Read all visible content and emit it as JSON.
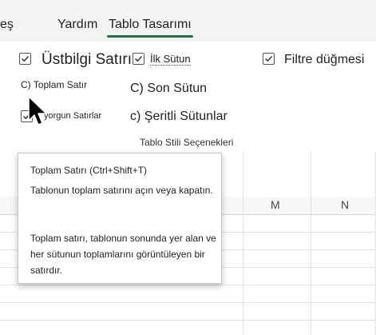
{
  "tabs": {
    "partial": "eş",
    "help": "Yardım",
    "table_design": "Tablo Tasarımı"
  },
  "ribbon": {
    "header_row": "Üstbilgi Satırı",
    "first_column": "İlk Sütun",
    "filter_button": "Filtre düğmesi",
    "total_row": "C) Toplam  Satır",
    "last_column": "C) Son Sütun",
    "banded_rows": "yorgun Satırlar",
    "banded_columns": "c) Şeritli Sütunlar",
    "group_label": "Tablo Stili Seçenekleri"
  },
  "columns": {
    "m": "M",
    "n": "N"
  },
  "tooltip": {
    "title": "Toplam Satırı (Ctrl+Shift+T)",
    "line1": "Tablonun toplam satırını açın veya kapatın.",
    "line2": "Toplam satırı, tablonun sonunda yer alan ve her sütunun toplamlarını görüntüleyen bir satırdır."
  }
}
